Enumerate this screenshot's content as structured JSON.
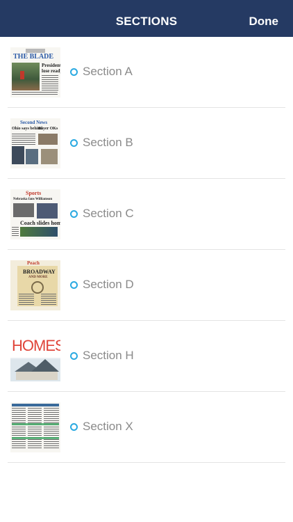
{
  "header": {
    "title": "SECTIONS",
    "done_label": "Done"
  },
  "sections": [
    {
      "label": "Section A",
      "thumb_icon": "front-page-newspaper-thumbnail"
    },
    {
      "label": "Section B",
      "thumb_icon": "second-news-newspaper-thumbnail"
    },
    {
      "label": "Section C",
      "thumb_icon": "sports-newspaper-thumbnail"
    },
    {
      "label": "Section D",
      "thumb_icon": "peach-newspaper-thumbnail"
    },
    {
      "label": "Section H",
      "thumb_icon": "homes-newspaper-thumbnail"
    },
    {
      "label": "Section X",
      "thumb_icon": "classifieds-newspaper-thumbnail"
    }
  ],
  "colors": {
    "navbar": "#253a63",
    "radio": "#29a9e1",
    "label": "#8a8a8a"
  }
}
